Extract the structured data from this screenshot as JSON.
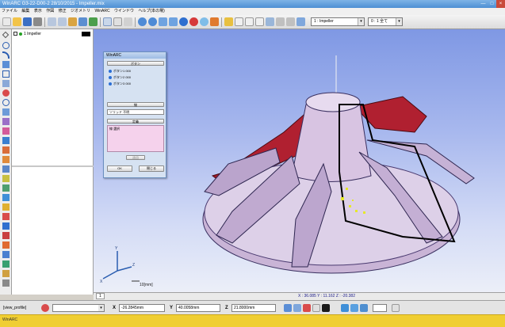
{
  "window": {
    "title": "WinARC G3-22-D00-2 28/10/2015 - Impeller.mix",
    "controls": [
      "—",
      "□",
      "×"
    ]
  },
  "menu": [
    "ファイル",
    "編集",
    "表示",
    "作図",
    "修正",
    "ジオメトリ",
    "WinARC",
    "ウインドウ",
    "ヘルプ(本の場)"
  ],
  "toolbar": {
    "layer_combo": "1 : Impeller",
    "scope_combo": "0 : 1 全て"
  },
  "tree": {
    "item_label": "1 Impeller"
  },
  "dialog": {
    "title": "WinARC",
    "section_top": "ボタン",
    "rows": [
      "ボタン1 000",
      "ボタン2 000",
      "ボタン3 000"
    ],
    "section_mid": "線",
    "field_value": "ソリッド 不明",
    "section_low": "定義",
    "pink_label": "線 選択",
    "apply_button": "適用",
    "ok_button": "OK",
    "cancel_button": "閉じる"
  },
  "viewport": {
    "scale_label": "10[mm]",
    "triad_labels": [
      "Y",
      "X",
      "Z"
    ],
    "tab_label": "1"
  },
  "coord_readout": "X : 36.085   Y : 11.162   Z : -20.382",
  "status": {
    "view_label": "[view_profile]",
    "x_label": "X",
    "x_value": "-26.2845mm",
    "y_label": "Y",
    "y_value": "40.0058mm",
    "z_label": "Z",
    "z_value": "21.8000mm"
  },
  "bottom_bar": {
    "text": "WinARC"
  },
  "colors": {
    "titlebar": "#4d8fd4",
    "viewport_top": "#7f98e4",
    "viewport_bottom": "#eceff8",
    "impeller_body": "#c9b4d6",
    "blade_red": "#b02030",
    "bottom_bar": "#f0ce32"
  }
}
